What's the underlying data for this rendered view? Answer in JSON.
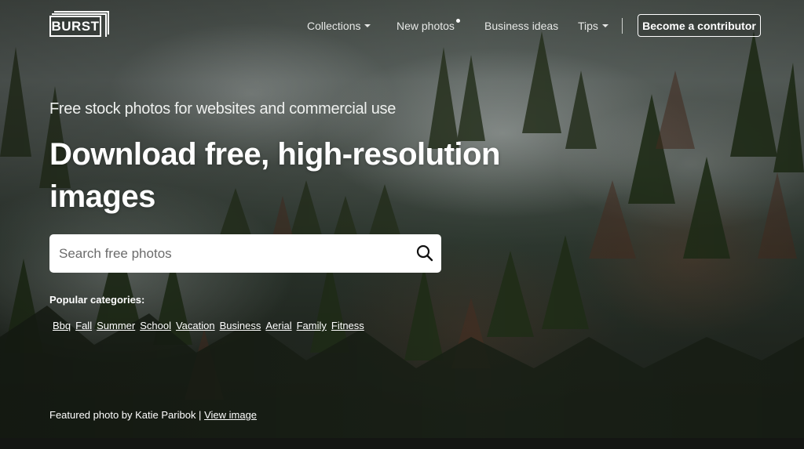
{
  "logo": {
    "text": "BURST"
  },
  "nav": {
    "collections": "Collections",
    "new_photos": "New photos",
    "business_ideas": "Business ideas",
    "tips": "Tips",
    "cta": "Become a contributor"
  },
  "hero": {
    "subtitle": "Free stock photos for websites and commercial use",
    "title": "Download free, high-resolution images"
  },
  "search": {
    "placeholder": "Search free photos",
    "value": ""
  },
  "categories": {
    "label": "Popular categories:",
    "items": [
      "Bbq",
      "Fall",
      "Summer",
      "School",
      "Vacation",
      "Business",
      "Aerial",
      "Family",
      "Fitness"
    ]
  },
  "featured": {
    "prefix": "Featured photo by Katie Paribok | ",
    "link": "View image"
  },
  "colors": {
    "search_bg": "#ffffff",
    "text": "#ffffff"
  }
}
